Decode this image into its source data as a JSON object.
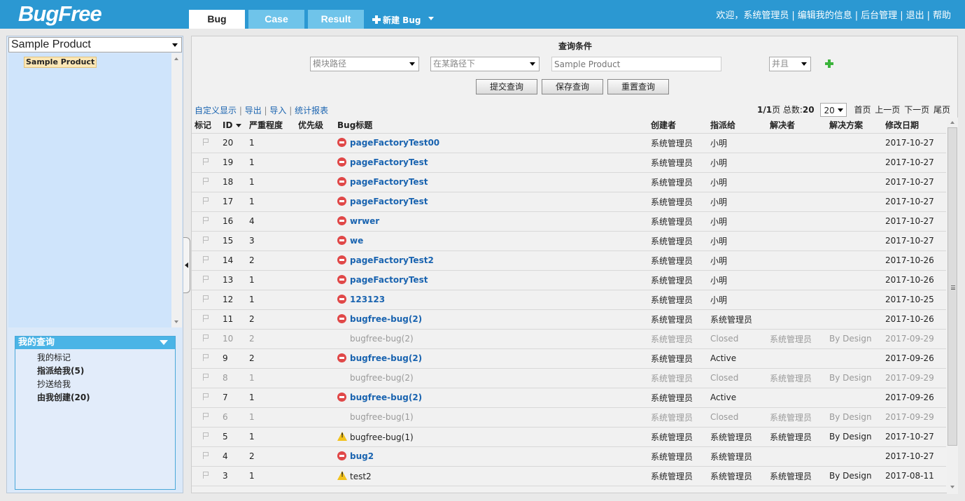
{
  "app": {
    "logo": "BugFree"
  },
  "tabs": [
    {
      "label": "Bug",
      "active": true
    },
    {
      "label": "Case",
      "active": false
    },
    {
      "label": "Result",
      "active": false
    }
  ],
  "new_bug_label": "新建 Bug",
  "user_nav": {
    "welcome": "欢迎，系统管理员",
    "edit_profile": "编辑我的信息",
    "admin": "后台管理",
    "logout": "退出",
    "help": "帮助"
  },
  "sidebar": {
    "product_select": "Sample Product",
    "tree_node": "Sample Product",
    "my_queries": {
      "title": "我的查询",
      "items": [
        {
          "label": "我的标记",
          "bold": false
        },
        {
          "label": "指派给我(5)",
          "bold": true
        },
        {
          "label": "抄送给我",
          "bold": false
        },
        {
          "label": "由我创建(20)",
          "bold": true
        }
      ]
    }
  },
  "query": {
    "title": "查询条件",
    "field_select": "模块路径",
    "operator_select": "在某路径下",
    "value_placeholder": "Sample Product",
    "logic_select": "并且",
    "buttons": {
      "submit": "提交查询",
      "save": "保存查询",
      "reset": "重置查询"
    }
  },
  "toolbar_links": {
    "custom": "自定义显示",
    "export": "导出",
    "import": "导入",
    "report": "统计报表"
  },
  "pager": {
    "page": "1/1",
    "page_suffix": "页 总数:",
    "total": "20",
    "page_size": "20",
    "first": "首页",
    "prev": "上一页",
    "next": "下一页",
    "last": "尾页"
  },
  "columns": [
    "标记",
    "ID",
    "严重程度",
    "优先级",
    "Bug标题",
    "创建者",
    "指派给",
    "解决者",
    "解决方案",
    "修改日期"
  ],
  "rows": [
    {
      "id": "20",
      "severity": "1",
      "priority": "",
      "icon": "stop",
      "title": "pageFactoryTest00",
      "creator": "系统管理员",
      "assignee": "小明",
      "resolver": "",
      "resolution": "",
      "date": "2017-10-27",
      "closed": false
    },
    {
      "id": "19",
      "severity": "1",
      "priority": "",
      "icon": "stop",
      "title": "pageFactoryTest",
      "creator": "系统管理员",
      "assignee": "小明",
      "resolver": "",
      "resolution": "",
      "date": "2017-10-27",
      "closed": false
    },
    {
      "id": "18",
      "severity": "1",
      "priority": "",
      "icon": "stop",
      "title": "pageFactoryTest",
      "creator": "系统管理员",
      "assignee": "小明",
      "resolver": "",
      "resolution": "",
      "date": "2017-10-27",
      "closed": false
    },
    {
      "id": "17",
      "severity": "1",
      "priority": "",
      "icon": "stop",
      "title": "pageFactoryTest",
      "creator": "系统管理员",
      "assignee": "小明",
      "resolver": "",
      "resolution": "",
      "date": "2017-10-27",
      "closed": false
    },
    {
      "id": "16",
      "severity": "4",
      "priority": "",
      "icon": "stop",
      "title": "wrwer",
      "creator": "系统管理员",
      "assignee": "小明",
      "resolver": "",
      "resolution": "",
      "date": "2017-10-27",
      "closed": false
    },
    {
      "id": "15",
      "severity": "3",
      "priority": "",
      "icon": "stop",
      "title": "we",
      "creator": "系统管理员",
      "assignee": "小明",
      "resolver": "",
      "resolution": "",
      "date": "2017-10-27",
      "closed": false
    },
    {
      "id": "14",
      "severity": "2",
      "priority": "",
      "icon": "stop",
      "title": "pageFactoryTest2",
      "creator": "系统管理员",
      "assignee": "小明",
      "resolver": "",
      "resolution": "",
      "date": "2017-10-26",
      "closed": false
    },
    {
      "id": "13",
      "severity": "1",
      "priority": "",
      "icon": "stop",
      "title": "pageFactoryTest",
      "creator": "系统管理员",
      "assignee": "小明",
      "resolver": "",
      "resolution": "",
      "date": "2017-10-26",
      "closed": false
    },
    {
      "id": "12",
      "severity": "1",
      "priority": "",
      "icon": "stop",
      "title": "123123",
      "creator": "系统管理员",
      "assignee": "小明",
      "resolver": "",
      "resolution": "",
      "date": "2017-10-25",
      "closed": false
    },
    {
      "id": "11",
      "severity": "2",
      "priority": "",
      "icon": "stop",
      "title": "bugfree-bug(2)",
      "creator": "系统管理员",
      "assignee": "系统管理员",
      "resolver": "",
      "resolution": "",
      "date": "2017-10-26",
      "closed": false
    },
    {
      "id": "10",
      "severity": "2",
      "priority": "",
      "icon": "none",
      "title": "bugfree-bug(2)",
      "creator": "系统管理员",
      "assignee": "Closed",
      "resolver": "系统管理员",
      "resolution": "By Design",
      "date": "2017-09-29",
      "closed": true
    },
    {
      "id": "9",
      "severity": "2",
      "priority": "",
      "icon": "stop",
      "title": "bugfree-bug(2)",
      "creator": "系统管理员",
      "assignee": "Active",
      "resolver": "",
      "resolution": "",
      "date": "2017-09-26",
      "closed": false
    },
    {
      "id": "8",
      "severity": "1",
      "priority": "",
      "icon": "none",
      "title": "bugfree-bug(2)",
      "creator": "系统管理员",
      "assignee": "Closed",
      "resolver": "系统管理员",
      "resolution": "By Design",
      "date": "2017-09-29",
      "closed": true
    },
    {
      "id": "7",
      "severity": "1",
      "priority": "",
      "icon": "stop",
      "title": "bugfree-bug(2)",
      "creator": "系统管理员",
      "assignee": "Active",
      "resolver": "",
      "resolution": "",
      "date": "2017-09-26",
      "closed": false
    },
    {
      "id": "6",
      "severity": "1",
      "priority": "",
      "icon": "none",
      "title": "bugfree-bug(1)",
      "creator": "系统管理员",
      "assignee": "Closed",
      "resolver": "系统管理员",
      "resolution": "By Design",
      "date": "2017-09-29",
      "closed": true
    },
    {
      "id": "5",
      "severity": "1",
      "priority": "",
      "icon": "warn",
      "title": "bugfree-bug(1)",
      "creator": "系统管理员",
      "assignee": "系统管理员",
      "resolver": "系统管理员",
      "resolution": "By Design",
      "date": "2017-10-27",
      "closed": false
    },
    {
      "id": "4",
      "severity": "2",
      "priority": "",
      "icon": "stop",
      "title": "bug2",
      "creator": "系统管理员",
      "assignee": "系统管理员",
      "resolver": "",
      "resolution": "",
      "date": "2017-10-27",
      "closed": false
    },
    {
      "id": "3",
      "severity": "1",
      "priority": "",
      "icon": "warn",
      "title": "test2",
      "creator": "系统管理员",
      "assignee": "系统管理员",
      "resolver": "系统管理员",
      "resolution": "By Design",
      "date": "2017-08-11",
      "closed": false
    }
  ]
}
